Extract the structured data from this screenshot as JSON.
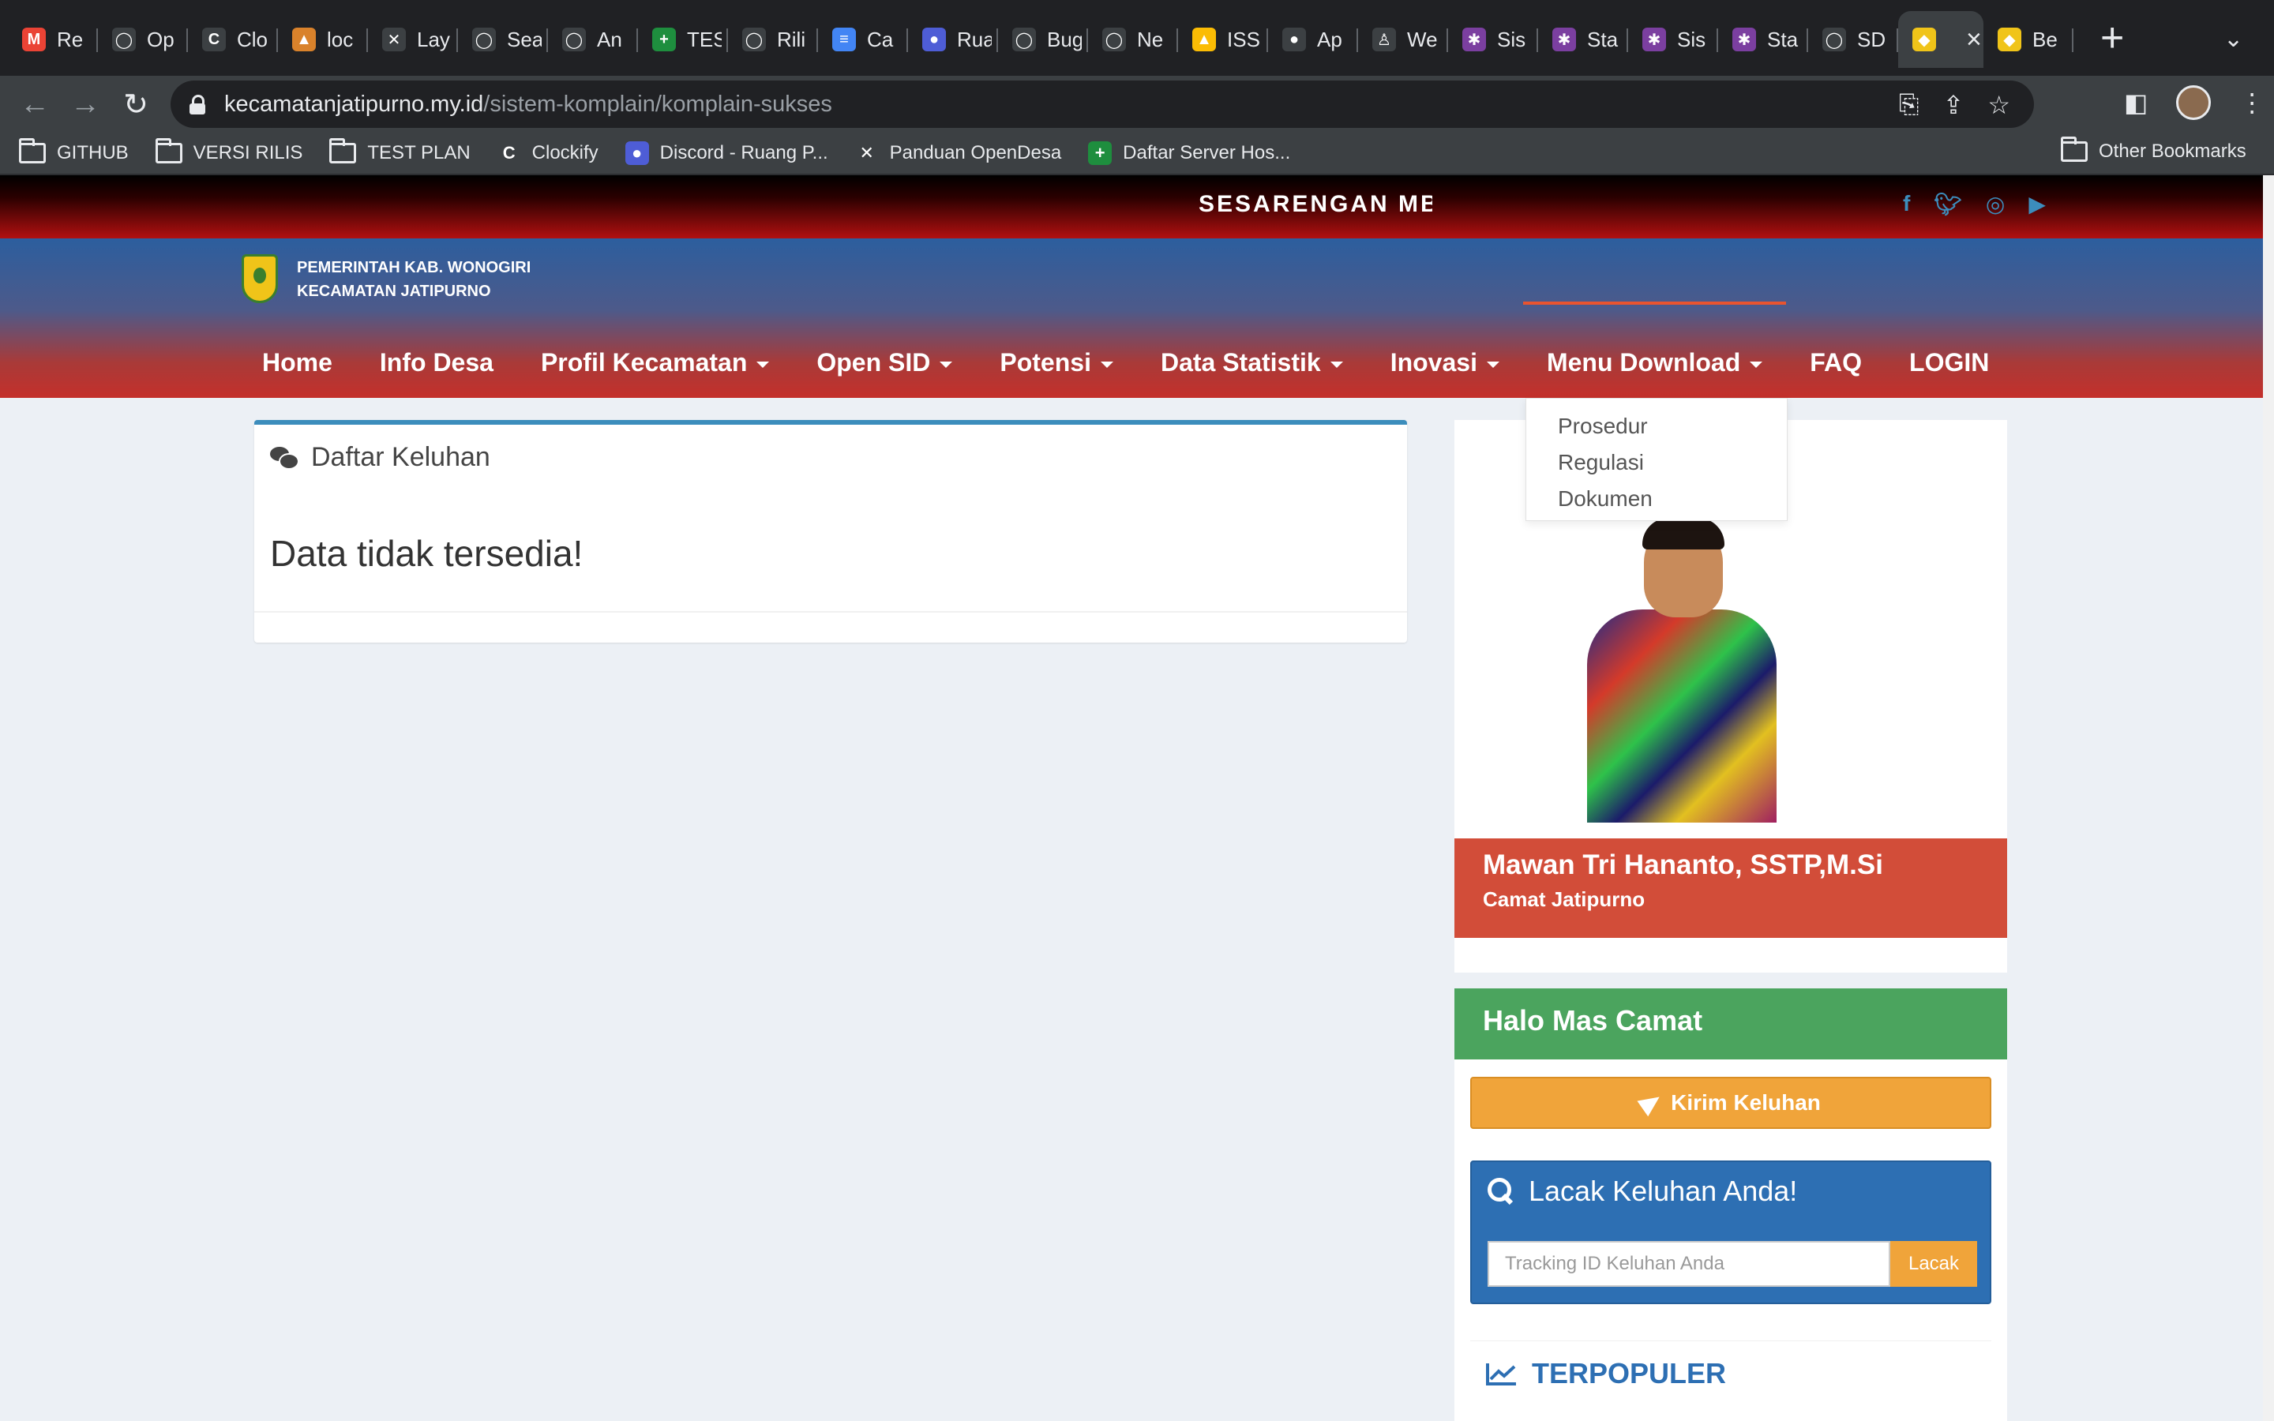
{
  "browser": {
    "tabs": [
      {
        "label": "Re",
        "icon": "gmail-icon",
        "color": "#ea4335",
        "glyph": "M"
      },
      {
        "label": "Op",
        "icon": "github-icon",
        "color": "#3c4043",
        "glyph": "◯"
      },
      {
        "label": "Clo",
        "icon": "clockify-icon",
        "color": "#3c4043",
        "glyph": "C"
      },
      {
        "label": "loc",
        "icon": "tent-icon",
        "color": "#d9822b",
        "glyph": "▲"
      },
      {
        "label": "Lay",
        "icon": "bird-icon",
        "color": "#3c4043",
        "glyph": "✕"
      },
      {
        "label": "Sea",
        "icon": "github-icon",
        "color": "#3c4043",
        "glyph": "◯"
      },
      {
        "label": "An",
        "icon": "github-icon",
        "color": "#3c4043",
        "glyph": "◯"
      },
      {
        "label": "TES",
        "icon": "sheets-icon",
        "color": "#1e8e3e",
        "glyph": "+"
      },
      {
        "label": "Rili",
        "icon": "github-icon",
        "color": "#3c4043",
        "glyph": "◯"
      },
      {
        "label": "Ca",
        "icon": "docs-icon",
        "color": "#4285f4",
        "glyph": "≡"
      },
      {
        "label": "Rua",
        "icon": "discord-icon",
        "color": "#4e5dd6",
        "glyph": "●"
      },
      {
        "label": "Bug",
        "icon": "github-icon",
        "color": "#3c4043",
        "glyph": "◯"
      },
      {
        "label": "Ne",
        "icon": "github-icon",
        "color": "#3c4043",
        "glyph": "◯"
      },
      {
        "label": "ISS",
        "icon": "drive-icon",
        "color": "#fbbc04",
        "glyph": "▲"
      },
      {
        "label": "Ap",
        "icon": "apple-icon",
        "color": "#3c4043",
        "glyph": "●"
      },
      {
        "label": "We",
        "icon": "logo-icon",
        "color": "#3c4043",
        "glyph": "♙"
      },
      {
        "label": "Sis",
        "icon": "star-logo-icon",
        "color": "#7b3fa0",
        "glyph": "✱"
      },
      {
        "label": "Sta",
        "icon": "star-logo-icon",
        "color": "#7b3fa0",
        "glyph": "✱"
      },
      {
        "label": "Sis",
        "icon": "star-logo-icon",
        "color": "#7b3fa0",
        "glyph": "✱"
      },
      {
        "label": "Sta",
        "icon": "star-logo-icon",
        "color": "#7b3fa0",
        "glyph": "✱"
      },
      {
        "label": "SD",
        "icon": "github-icon",
        "color": "#3c4043",
        "glyph": "◯"
      },
      {
        "label": "",
        "icon": "shield-logo-icon",
        "color": "#f0c419",
        "glyph": "◆",
        "active": true
      },
      {
        "label": "Be",
        "icon": "shield-logo-icon",
        "color": "#f0c419",
        "glyph": "◆"
      }
    ],
    "url_host": "kecamatanjatipurno.my.id",
    "url_path": "/sistem-komplain/komplain-sukses",
    "bookmarks": [
      {
        "label": "GITHUB",
        "type": "folder"
      },
      {
        "label": "VERSI RILIS",
        "type": "folder"
      },
      {
        "label": "TEST PLAN",
        "type": "folder"
      },
      {
        "label": "Clockify",
        "type": "site",
        "color": "#3c4043",
        "glyph": "C"
      },
      {
        "label": "Discord - Ruang P...",
        "type": "site",
        "color": "#4e5dd6",
        "glyph": "●"
      },
      {
        "label": "Panduan OpenDesa",
        "type": "site",
        "color": "#3c4043",
        "glyph": "✕"
      },
      {
        "label": "Daftar Server Hos...",
        "type": "site",
        "color": "#1e8e3e",
        "glyph": "+"
      }
    ],
    "other_bookmarks": "Other Bookmarks"
  },
  "site": {
    "marquee": "SESARENGAN MBA",
    "brand_line1": "PEMERINTAH KAB. WONOGIRI",
    "brand_line2": "KECAMATAN JATIPURNO",
    "nav": [
      {
        "label": "Home",
        "caret": false
      },
      {
        "label": "Info Desa",
        "caret": false
      },
      {
        "label": "Profil Kecamatan",
        "caret": true
      },
      {
        "label": "Open SID",
        "caret": true
      },
      {
        "label": "Potensi",
        "caret": true
      },
      {
        "label": "Data Statistik",
        "caret": true
      },
      {
        "label": "Inovasi",
        "caret": true
      },
      {
        "label": "Menu Download",
        "caret": true,
        "open": true
      },
      {
        "label": "FAQ",
        "caret": false
      },
      {
        "label": "LOGIN",
        "caret": false
      }
    ],
    "dropdown": [
      "Prosedur",
      "Regulasi",
      "Dokumen"
    ],
    "panel_title": "Daftar Keluhan",
    "panel_message": "Data tidak tersedia!",
    "official_name": "Mawan Tri Hananto, SSTP,M.Si",
    "official_role": "Camat Jatipurno",
    "halo_title": "Halo Mas Camat",
    "send_button": "Kirim Keluhan",
    "track_title": "Lacak Keluhan Anda!",
    "track_placeholder": "Tracking ID Keluhan Anda",
    "track_button": "Lacak",
    "popular_title": "TERPOPULER"
  },
  "colors": {
    "accent_blue": "#3c8dbc",
    "red_box": "#d24d39",
    "green_box": "#4ba45e",
    "orange_button": "#f0a43a"
  }
}
